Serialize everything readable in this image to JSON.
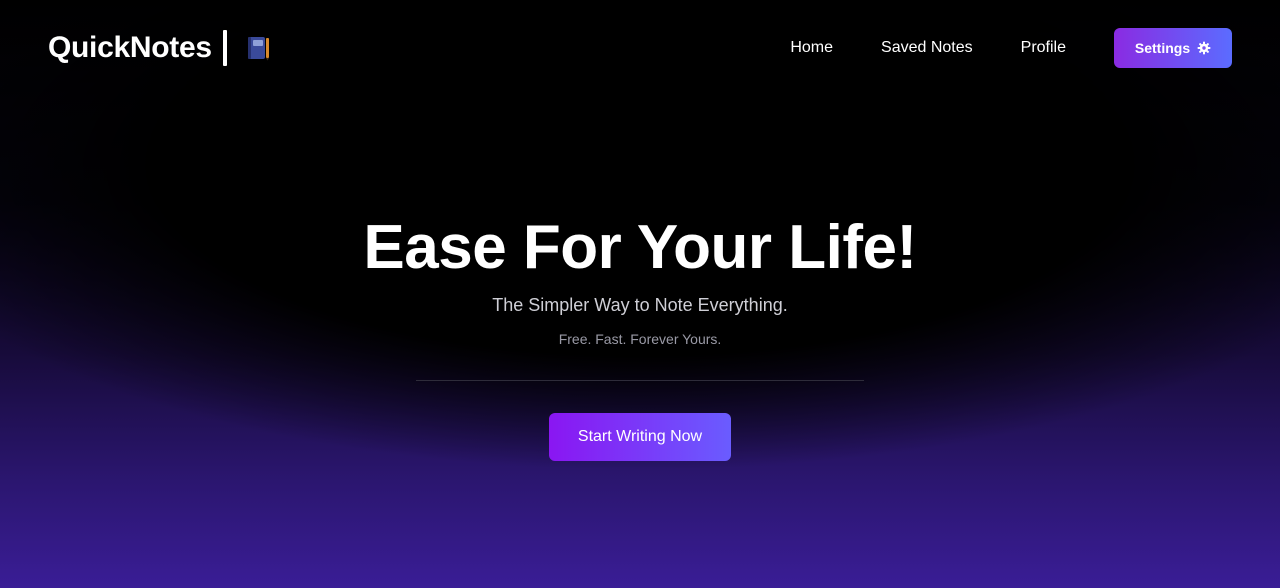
{
  "header": {
    "brand_name": "QuickNotes",
    "brand_icon": "notebook-icon",
    "nav_items": [
      {
        "label": "Home"
      },
      {
        "label": "Saved Notes"
      },
      {
        "label": "Profile"
      }
    ],
    "settings_label": "Settings",
    "settings_icon": "gear-icon"
  },
  "hero": {
    "title": "Ease For Your Life!",
    "subtitle": "The Simpler Way to Note Everything.",
    "tagline": "Free. Fast. Forever Yours.",
    "cta_label": "Start Writing Now"
  },
  "colors": {
    "accent_purple": "#8a2be2",
    "accent_blue": "#5b6cff",
    "background_top": "#000000",
    "background_bottom": "#3a1d96"
  }
}
